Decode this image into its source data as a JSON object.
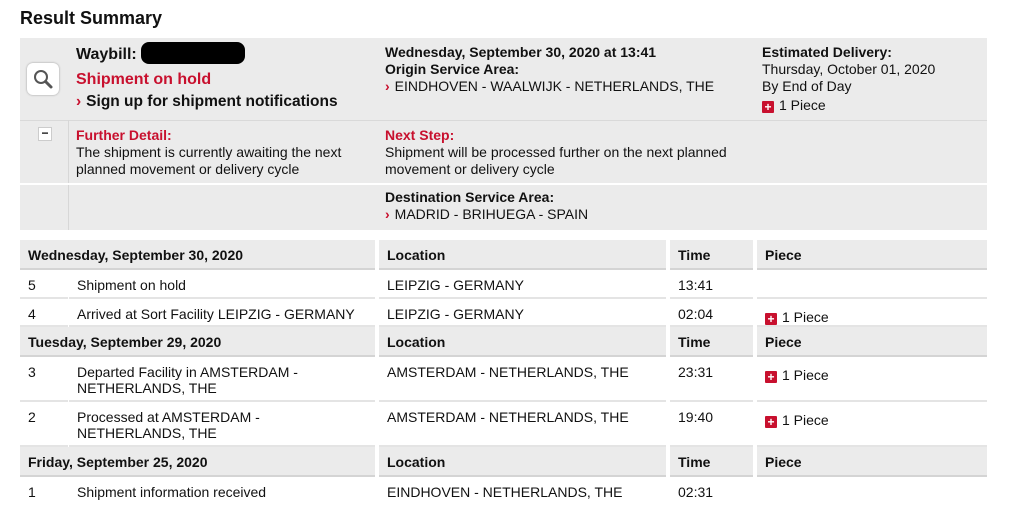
{
  "page_title": "Result Summary",
  "summary": {
    "waybill_label": "Waybill:",
    "status": "Shipment on hold",
    "signup_link": "Sign up for shipment notifications",
    "datetime": "Wednesday, September 30, 2020 at 13:41",
    "origin_label": "Origin Service Area:",
    "origin_value": "EINDHOVEN - WAALWIJK - NETHERLANDS, THE",
    "est_label": "Estimated Delivery:",
    "est_date": "Thursday, October 01, 2020",
    "est_time": "By End of Day",
    "pieces": "1 Piece",
    "further_label": "Further Detail:",
    "further_text_1": "The shipment is currently awaiting the next",
    "further_text_2": "planned movement or delivery cycle",
    "next_label": "Next Step:",
    "next_text_1": "Shipment will be processed further on the next planned",
    "next_text_2": "movement or delivery cycle",
    "dest_label": "Destination Service Area:",
    "dest_value": "MADRID - BRIHUEGA - SPAIN"
  },
  "history": {
    "col_location": "Location",
    "col_time": "Time",
    "col_piece": "Piece",
    "day1": {
      "date": "Wednesday, September 30, 2020",
      "rows": [
        {
          "num": "5",
          "desc": "Shipment on hold",
          "loc": "LEIPZIG - GERMANY",
          "time": "13:41",
          "piece": ""
        },
        {
          "num": "4",
          "desc": "Arrived at Sort Facility LEIPZIG - GERMANY",
          "loc": "LEIPZIG - GERMANY",
          "time": "02:04",
          "piece": "1 Piece"
        }
      ]
    },
    "day2": {
      "date": "Tuesday, September 29, 2020",
      "rows": [
        {
          "num": "3",
          "desc1": "Departed Facility in AMSTERDAM -",
          "desc2": "NETHERLANDS, THE",
          "loc": "AMSTERDAM - NETHERLANDS, THE",
          "time": "23:31",
          "piece": "1 Piece"
        },
        {
          "num": "2",
          "desc1": "Processed at AMSTERDAM -",
          "desc2": "NETHERLANDS, THE",
          "loc": "AMSTERDAM - NETHERLANDS, THE",
          "time": "19:40",
          "piece": "1 Piece"
        }
      ]
    },
    "day3": {
      "date": "Friday, September 25, 2020",
      "rows": [
        {
          "num": "1",
          "desc": "Shipment information received",
          "loc": "EINDHOVEN - NETHERLANDS, THE",
          "time": "02:31",
          "piece": ""
        }
      ]
    }
  },
  "icons": {
    "search": "magnifier-icon",
    "plus": "plus-box-icon",
    "minus": "minus-box-icon",
    "chevron": "chevron-right-icon"
  },
  "colors": {
    "accent_red": "#c8102e",
    "panel_gray": "#ebebeb"
  }
}
